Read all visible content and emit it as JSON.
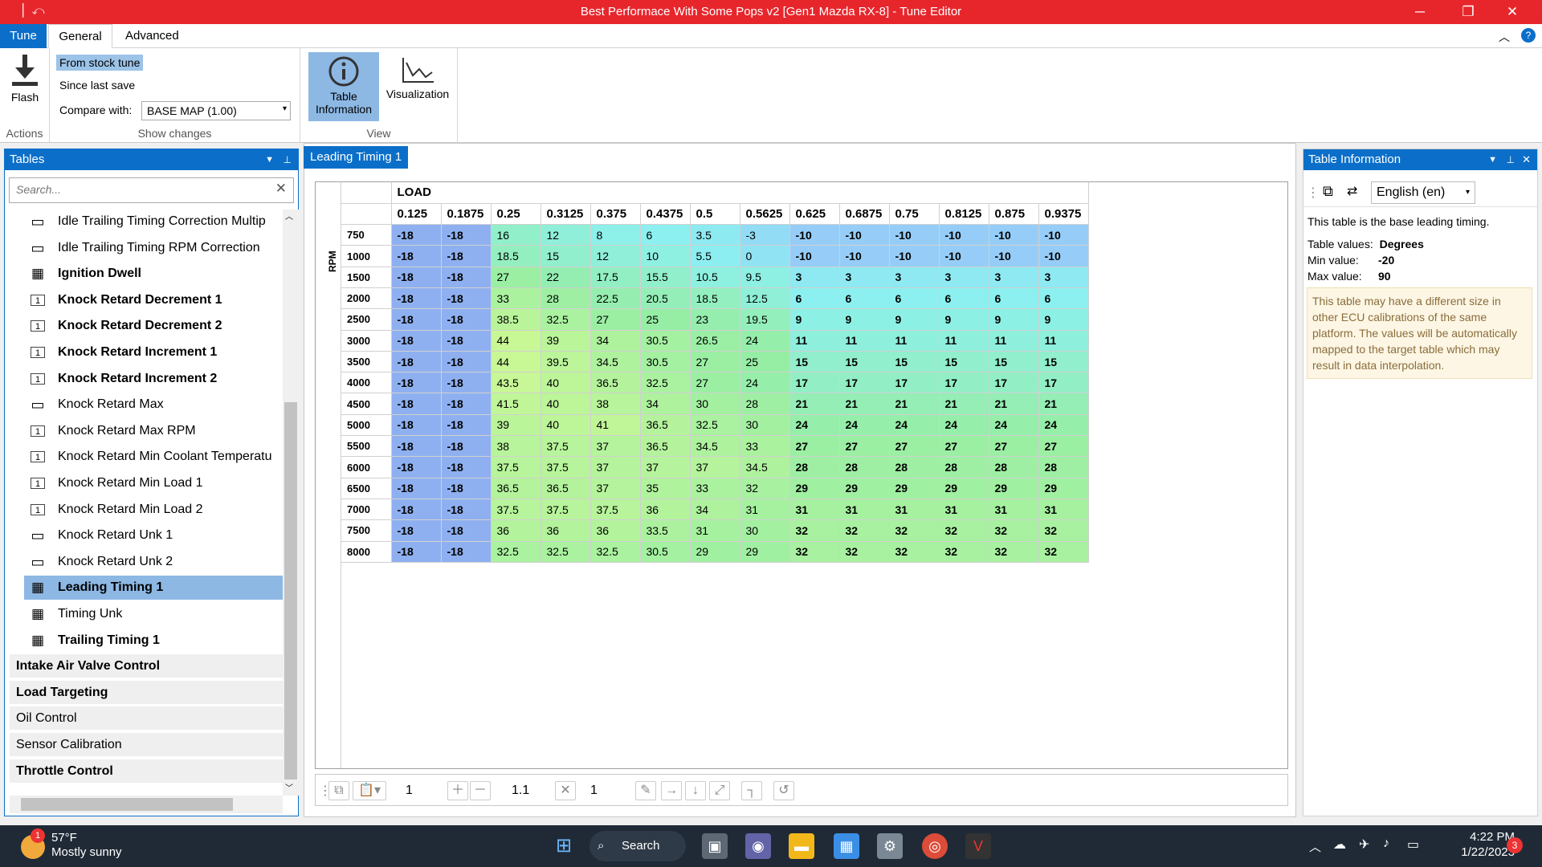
{
  "window": {
    "title": "Best Performace With Some Pops v2 [Gen1 Mazda RX-8] - Tune Editor"
  },
  "ribbon": {
    "tabs": [
      "Tune",
      "General",
      "Advanced"
    ],
    "flash_label": "Flash",
    "actions_label": "Actions",
    "from_stock": "From stock tune",
    "since_last": "Since last save",
    "compare_label": "Compare with:",
    "compare_value": "BASE MAP (1.00)",
    "show_changes_label": "Show changes",
    "table_info_label1": "Table",
    "table_info_label2": "Information",
    "visualization_label": "Visualization",
    "view_label": "View"
  },
  "tables_panel": {
    "title": "Tables",
    "search_placeholder": "Search...",
    "items": [
      {
        "label": "Idle Trailing Timing Correction Multip",
        "icon": "row",
        "bold": false
      },
      {
        "label": "Idle Trailing Timing RPM Correction",
        "icon": "row",
        "bold": false
      },
      {
        "label": "Ignition Dwell",
        "icon": "grid",
        "bold": true
      },
      {
        "label": "Knock Retard Decrement 1",
        "icon": "one",
        "bold": true
      },
      {
        "label": "Knock Retard Decrement 2",
        "icon": "one",
        "bold": true
      },
      {
        "label": "Knock Retard Increment 1",
        "icon": "one",
        "bold": true
      },
      {
        "label": "Knock Retard Increment 2",
        "icon": "one",
        "bold": true
      },
      {
        "label": "Knock Retard Max",
        "icon": "row",
        "bold": false
      },
      {
        "label": "Knock Retard Max RPM",
        "icon": "one",
        "bold": false
      },
      {
        "label": "Knock Retard Min Coolant Temperatu",
        "icon": "one",
        "bold": false
      },
      {
        "label": "Knock Retard Min Load 1",
        "icon": "one",
        "bold": false
      },
      {
        "label": "Knock Retard Min Load 2",
        "icon": "one",
        "bold": false
      },
      {
        "label": "Knock Retard Unk 1",
        "icon": "row",
        "bold": false
      },
      {
        "label": "Knock Retard Unk 2",
        "icon": "row",
        "bold": false
      },
      {
        "label": "Leading Timing 1",
        "icon": "grid",
        "bold": true,
        "selected": true
      },
      {
        "label": "Timing Unk",
        "icon": "grid",
        "bold": false
      },
      {
        "label": "Trailing Timing 1",
        "icon": "grid",
        "bold": true
      }
    ],
    "categories": [
      {
        "label": "Intake Air Valve Control",
        "bold": true
      },
      {
        "label": "Load Targeting",
        "bold": true
      },
      {
        "label": "Oil Control",
        "bold": false
      },
      {
        "label": "Sensor Calibration",
        "bold": false
      },
      {
        "label": "Throttle Control",
        "bold": true
      }
    ]
  },
  "document": {
    "tab": "Leading Timing 1",
    "load_label": "LOAD",
    "rpm_label": "RPM",
    "columns": [
      "0.125",
      "0.1875",
      "0.25",
      "0.3125",
      "0.375",
      "0.4375",
      "0.5",
      "0.5625",
      "0.625",
      "0.6875",
      "0.75",
      "0.8125",
      "0.875",
      "0.9375"
    ],
    "rows": [
      {
        "rpm": "750",
        "v": [
          "-18",
          "-18",
          "16",
          "12",
          "8",
          "6",
          "3.5",
          "-3",
          "-10",
          "-10",
          "-10",
          "-10",
          "-10",
          "-10"
        ]
      },
      {
        "rpm": "1000",
        "v": [
          "-18",
          "-18",
          "18.5",
          "15",
          "12",
          "10",
          "5.5",
          "0",
          "-10",
          "-10",
          "-10",
          "-10",
          "-10",
          "-10"
        ]
      },
      {
        "rpm": "1500",
        "v": [
          "-18",
          "-18",
          "27",
          "22",
          "17.5",
          "15.5",
          "10.5",
          "9.5",
          "3",
          "3",
          "3",
          "3",
          "3",
          "3"
        ]
      },
      {
        "rpm": "2000",
        "v": [
          "-18",
          "-18",
          "33",
          "28",
          "22.5",
          "20.5",
          "18.5",
          "12.5",
          "6",
          "6",
          "6",
          "6",
          "6",
          "6"
        ]
      },
      {
        "rpm": "2500",
        "v": [
          "-18",
          "-18",
          "38.5",
          "32.5",
          "27",
          "25",
          "23",
          "19.5",
          "9",
          "9",
          "9",
          "9",
          "9",
          "9"
        ]
      },
      {
        "rpm": "3000",
        "v": [
          "-18",
          "-18",
          "44",
          "39",
          "34",
          "30.5",
          "26.5",
          "24",
          "11",
          "11",
          "11",
          "11",
          "11",
          "11"
        ]
      },
      {
        "rpm": "3500",
        "v": [
          "-18",
          "-18",
          "44",
          "39.5",
          "34.5",
          "30.5",
          "27",
          "25",
          "15",
          "15",
          "15",
          "15",
          "15",
          "15"
        ]
      },
      {
        "rpm": "4000",
        "v": [
          "-18",
          "-18",
          "43.5",
          "40",
          "36.5",
          "32.5",
          "27",
          "24",
          "17",
          "17",
          "17",
          "17",
          "17",
          "17"
        ]
      },
      {
        "rpm": "4500",
        "v": [
          "-18",
          "-18",
          "41.5",
          "40",
          "38",
          "34",
          "30",
          "28",
          "21",
          "21",
          "21",
          "21",
          "21",
          "21"
        ]
      },
      {
        "rpm": "5000",
        "v": [
          "-18",
          "-18",
          "39",
          "40",
          "41",
          "36.5",
          "32.5",
          "30",
          "24",
          "24",
          "24",
          "24",
          "24",
          "24"
        ]
      },
      {
        "rpm": "5500",
        "v": [
          "-18",
          "-18",
          "38",
          "37.5",
          "37",
          "36.5",
          "34.5",
          "33",
          "27",
          "27",
          "27",
          "27",
          "27",
          "27"
        ]
      },
      {
        "rpm": "6000",
        "v": [
          "-18",
          "-18",
          "37.5",
          "37.5",
          "37",
          "37",
          "37",
          "34.5",
          "28",
          "28",
          "28",
          "28",
          "28",
          "28"
        ]
      },
      {
        "rpm": "6500",
        "v": [
          "-18",
          "-18",
          "36.5",
          "36.5",
          "37",
          "35",
          "33",
          "32",
          "29",
          "29",
          "29",
          "29",
          "29",
          "29"
        ]
      },
      {
        "rpm": "7000",
        "v": [
          "-18",
          "-18",
          "37.5",
          "37.5",
          "37.5",
          "36",
          "34",
          "31",
          "31",
          "31",
          "31",
          "31",
          "31",
          "31"
        ]
      },
      {
        "rpm": "7500",
        "v": [
          "-18",
          "-18",
          "36",
          "36",
          "36",
          "33.5",
          "31",
          "30",
          "32",
          "32",
          "32",
          "32",
          "32",
          "32"
        ]
      },
      {
        "rpm": "8000",
        "v": [
          "-18",
          "-18",
          "32.5",
          "32.5",
          "32.5",
          "30.5",
          "29",
          "29",
          "32",
          "32",
          "32",
          "32",
          "32",
          "32"
        ]
      }
    ],
    "toolbar": {
      "v1": "1",
      "v2": "1.1",
      "v3": "1"
    }
  },
  "info_panel": {
    "title": "Table Information",
    "language": "English (en)",
    "description": "This table is the base leading timing.",
    "values_label": "Table values:",
    "values": "Degrees",
    "min_label": "Min value:",
    "min": "-20",
    "max_label": "Max value:",
    "max": "90",
    "note": "This table may have a different size in other ECU calibrations of the same platform. The values will be automatically mapped to the target table which may result in data interpolation."
  },
  "taskbar": {
    "weather_temp": "57°F",
    "weather_desc": "Mostly sunny",
    "weather_badge": "1",
    "search": "Search",
    "time": "4:22 PM",
    "date": "1/22/2023",
    "notif": "3"
  }
}
